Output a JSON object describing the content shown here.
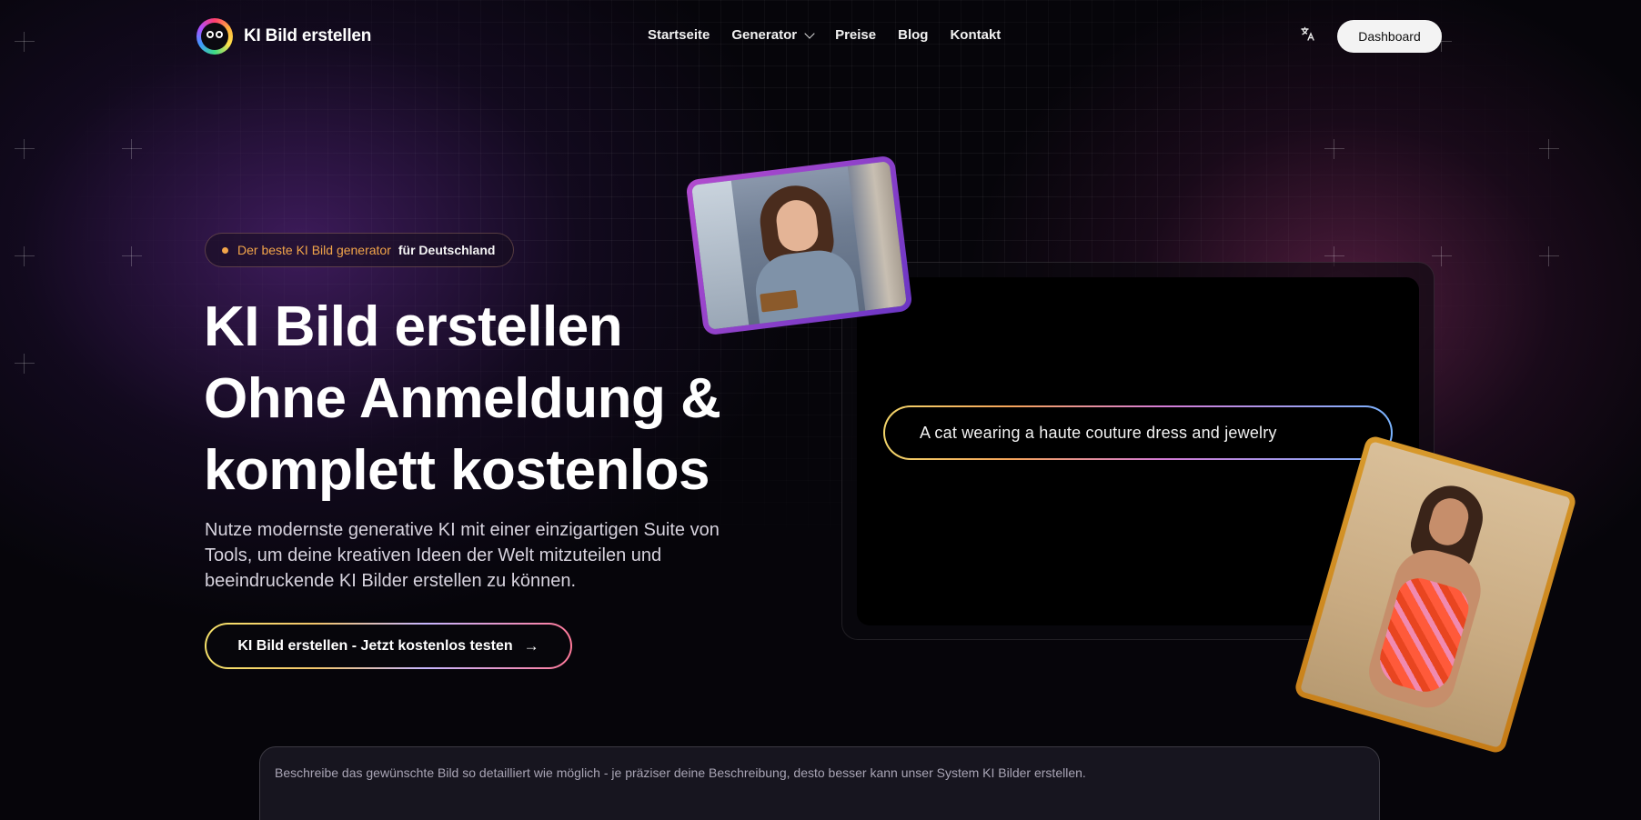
{
  "brand": {
    "name": "KI Bild erstellen",
    "logo_icon": "googly-eyes-logo-icon"
  },
  "nav": {
    "items": [
      {
        "label": "Startseite",
        "active": true
      },
      {
        "label": "Generator",
        "has_dropdown": true
      },
      {
        "label": "Preise"
      },
      {
        "label": "Blog"
      },
      {
        "label": "Kontakt"
      }
    ],
    "language_icon": "translate-icon",
    "dashboard_label": "Dashboard"
  },
  "hero": {
    "badge_highlight": "Der beste KI Bild generator",
    "badge_rest": "für Deutschland",
    "title_lines": [
      "KI Bild erstellen",
      "Ohne Anmeldung &",
      "komplett kostenlos"
    ],
    "subtitle": "Nutze modernste generative KI mit einer einzigartigen Suite von Tools, um deine kreativen Ideen der Welt mitzuteilen und beeindruckende KI Bilder erstellen zu können.",
    "cta_label": "KI Bild erstellen - Jetzt kostenlos testen",
    "cta_arrow": "→"
  },
  "showcase": {
    "prompt_text": "A cat wearing a haute couture dress and jewelry",
    "photo_top": "woman-in-sweater-photo",
    "photo_bottom": "woman-in-swimsuit-photo"
  },
  "description_box": {
    "placeholder": "Beschreibe das gewünschte Bild so detailliert wie möglich - je präziser deine Beschreibung, desto besser kann unser System KI Bilder erstellen."
  },
  "colors": {
    "background": "#06050a",
    "badge_accent": "#f2a54a",
    "photo_top_border": "#b24ccf",
    "photo_bottom_border": "#d89a2c"
  }
}
